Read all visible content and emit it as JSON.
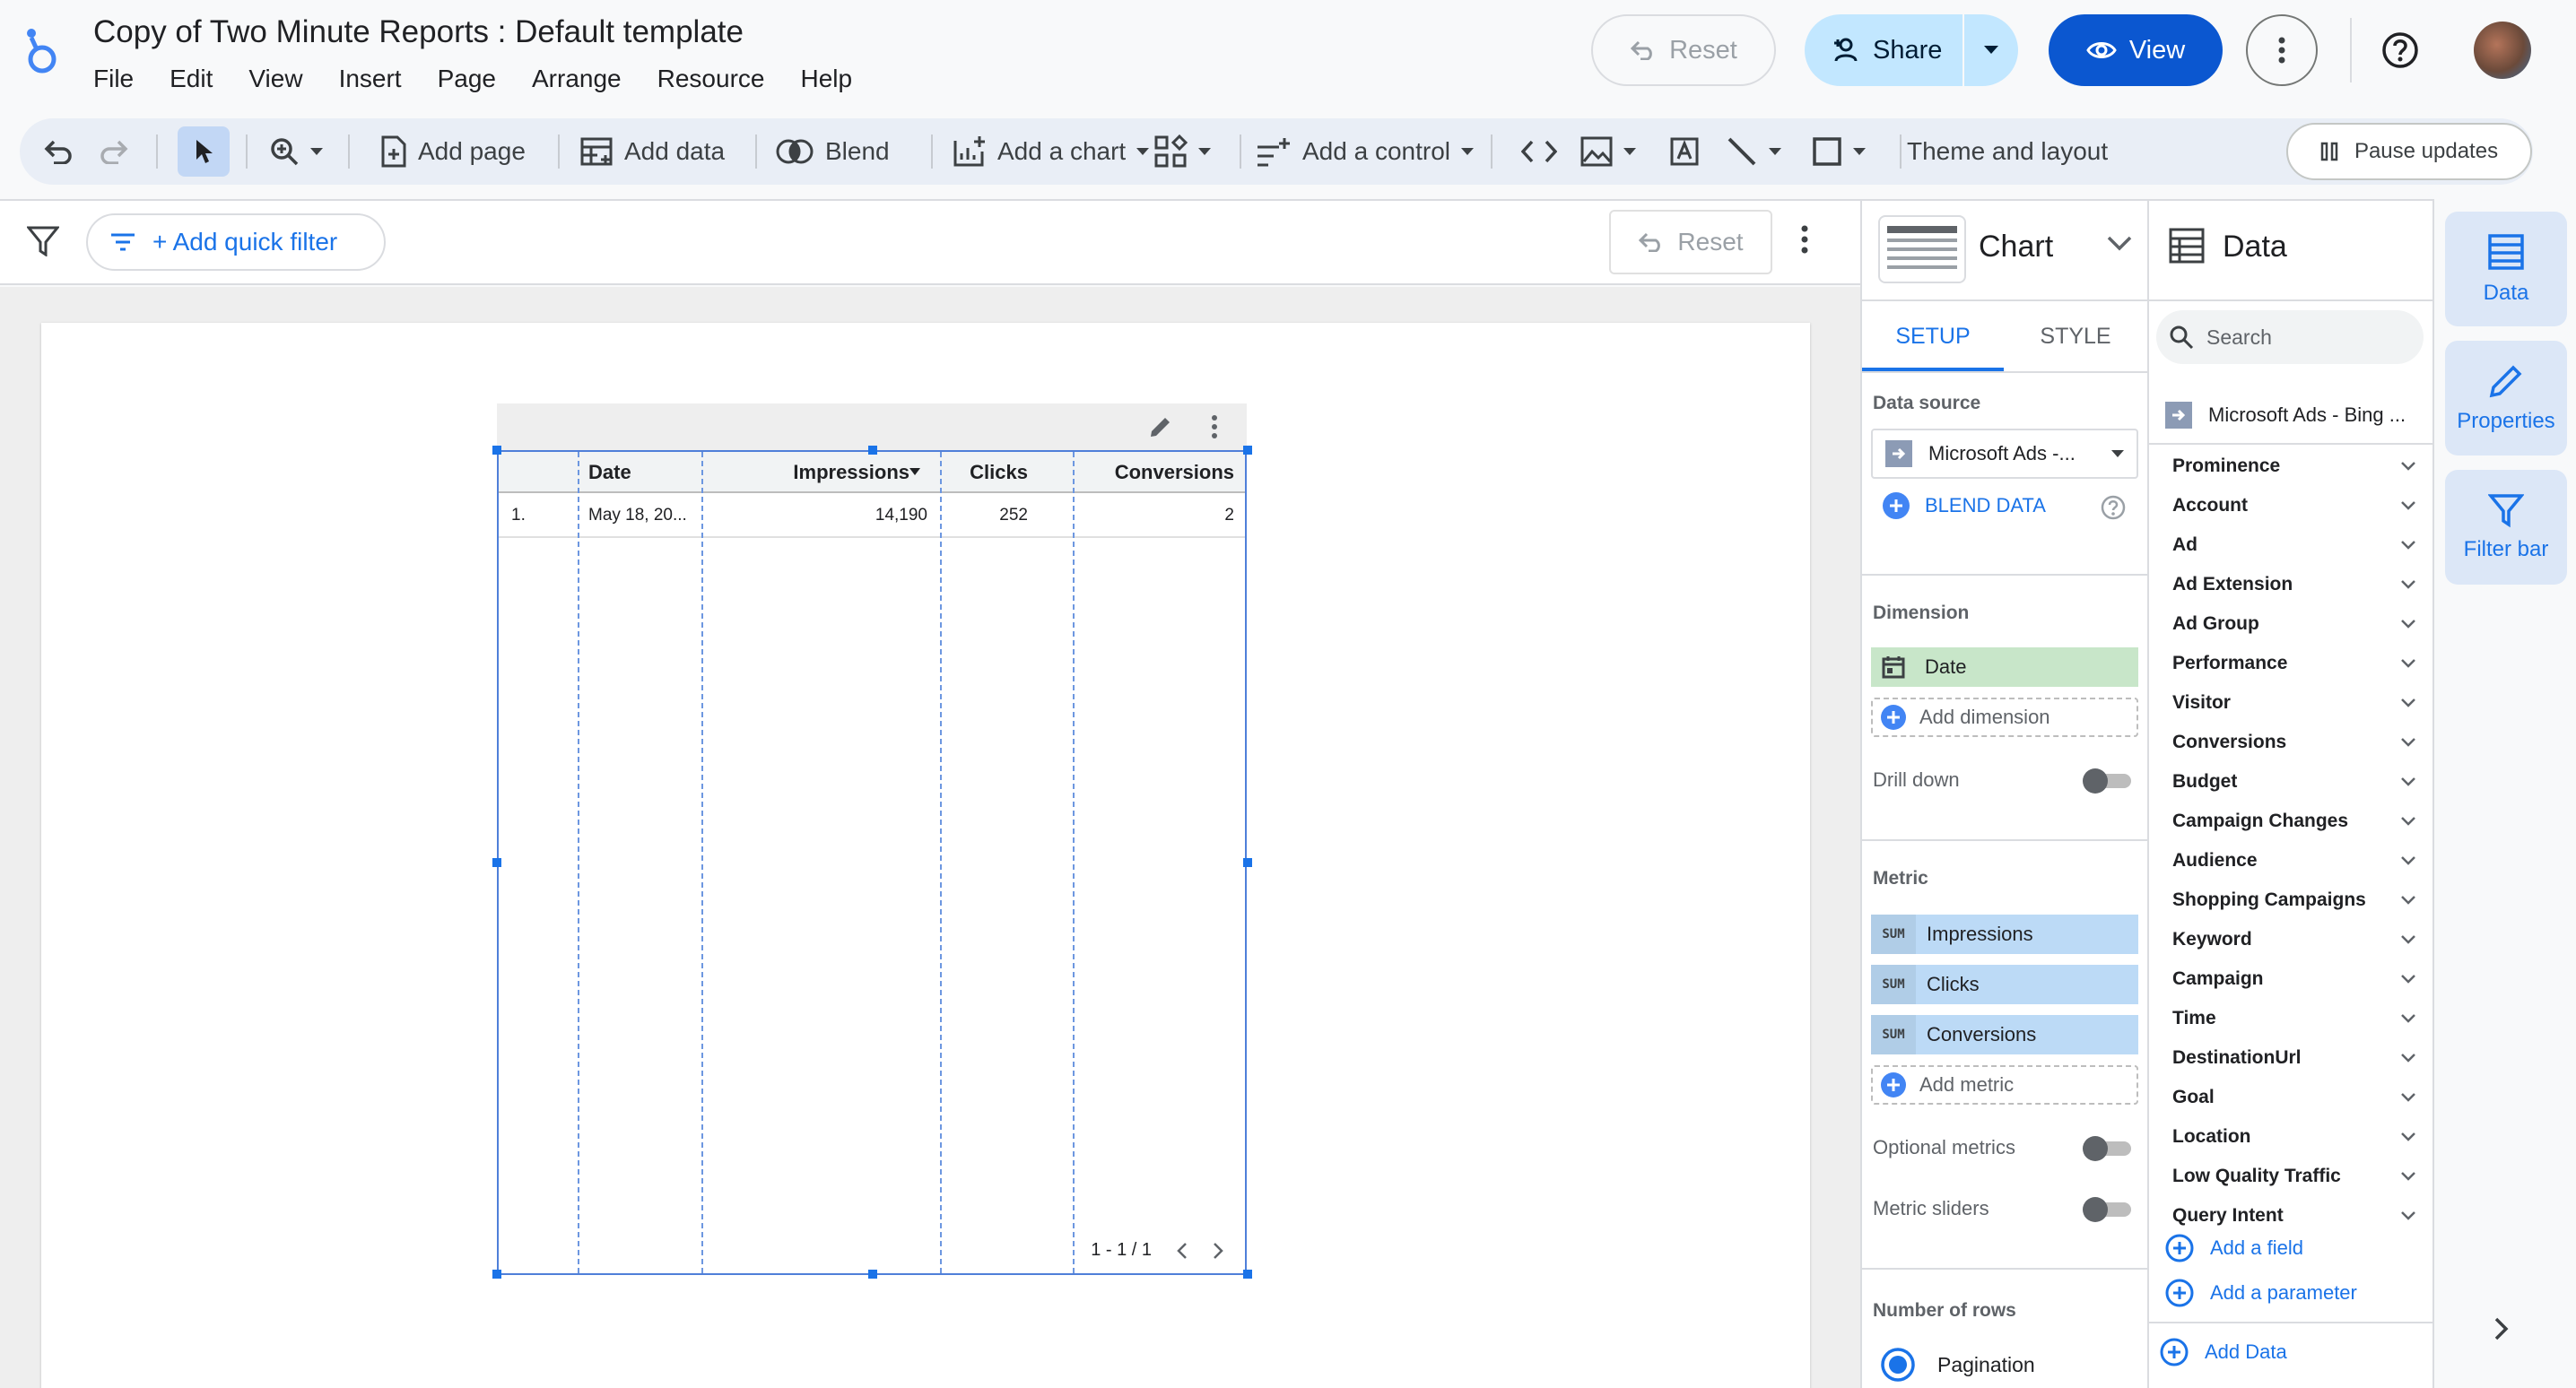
{
  "app": {
    "document_title": "Copy of Two Minute Reports : Default template",
    "menu": [
      "File",
      "Edit",
      "View",
      "Insert",
      "Page",
      "Arrange",
      "Resource",
      "Help"
    ],
    "reset_label": "Reset",
    "share_label": "Share",
    "view_label": "View"
  },
  "toolbar": {
    "add_page": "Add page",
    "add_data": "Add data",
    "blend": "Blend",
    "add_chart": "Add a chart",
    "add_control": "Add a control",
    "theme_layout": "Theme and layout",
    "pause_updates": "Pause updates"
  },
  "filter_bar": {
    "add_quick_filter": "+ Add quick filter",
    "reset_label": "Reset"
  },
  "table": {
    "columns": [
      "Date",
      "Impressions",
      "Clicks",
      "Conversions"
    ],
    "sorted_column": "Impressions",
    "rows": [
      {
        "index": "1.",
        "date": "May 18, 20...",
        "impressions": "14,190",
        "clicks": "252",
        "conversions": "2"
      }
    ],
    "pagination": "1 - 1 / 1"
  },
  "chart_panel": {
    "title": "Chart",
    "tabs": [
      "SETUP",
      "STYLE"
    ],
    "active_tab": "SETUP",
    "data_source_label": "Data source",
    "data_source_value": "Microsoft Ads -...",
    "blend_data": "BLEND DATA",
    "dimension_label": "Dimension",
    "dimension": "Date",
    "add_dimension": "Add dimension",
    "drill_down": "Drill down",
    "metric_label": "Metric",
    "metrics": [
      {
        "agg": "SUM",
        "name": "Impressions"
      },
      {
        "agg": "SUM",
        "name": "Clicks"
      },
      {
        "agg": "SUM",
        "name": "Conversions"
      }
    ],
    "add_metric": "Add metric",
    "optional_metrics": "Optional metrics",
    "metric_sliders": "Metric sliders",
    "number_of_rows": "Number of rows",
    "pagination": "Pagination"
  },
  "data_panel": {
    "title": "Data",
    "search_placeholder": "Search",
    "source": "Microsoft Ads - Bing ...",
    "groups": [
      "Prominence",
      "Account",
      "Ad",
      "Ad Extension",
      "Ad Group",
      "Performance",
      "Visitor",
      "Conversions",
      "Budget",
      "Campaign Changes",
      "Audience",
      "Shopping Campaigns",
      "Keyword",
      "Campaign",
      "Time",
      "DestinationUrl",
      "Goal",
      "Location",
      "Low Quality Traffic",
      "Query Intent"
    ],
    "add_field": "Add a field",
    "add_parameter": "Add a parameter",
    "add_data": "Add Data"
  },
  "side_rail": {
    "data": "Data",
    "properties": "Properties",
    "filter_bar": "Filter bar"
  },
  "colors": {
    "accent": "#1a73e8",
    "view_button": "#0b57d0",
    "share_button": "#c2e7ff",
    "dimension_chip": "#c8e6c9",
    "metric_chip": "#bcdaf6"
  }
}
